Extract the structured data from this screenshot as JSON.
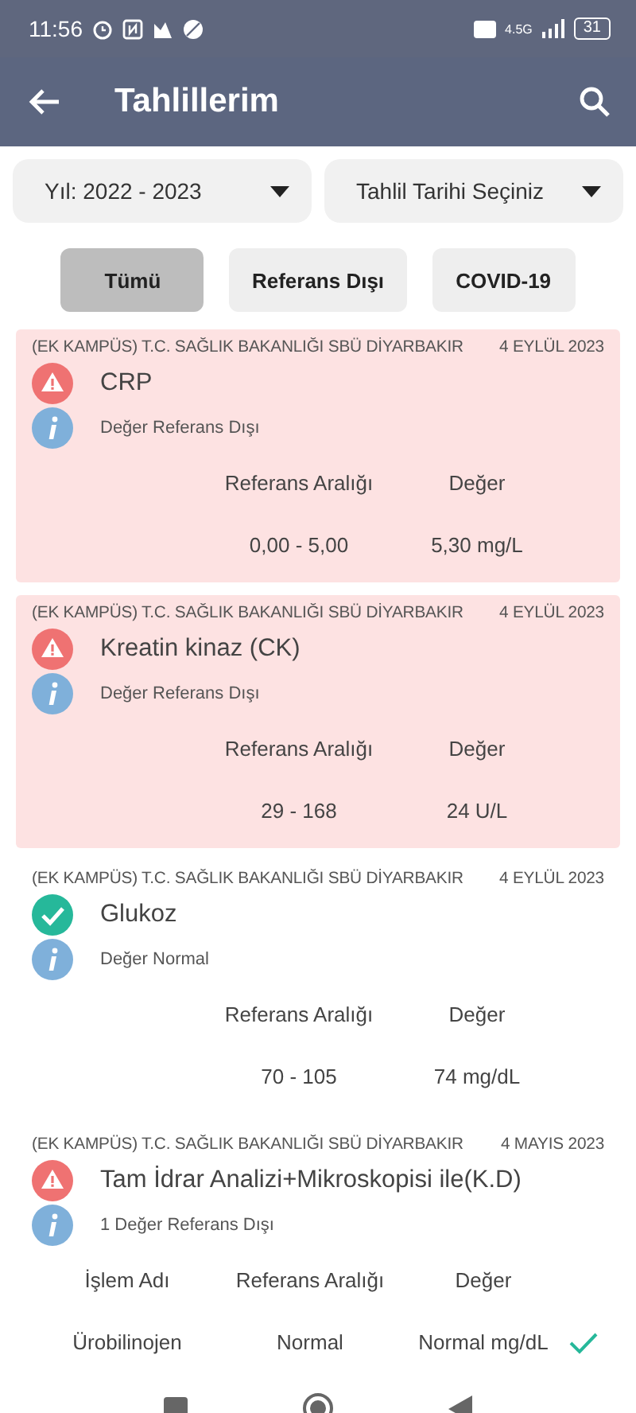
{
  "status_bar": {
    "time": "11:56",
    "network": "4.5G",
    "battery": "31"
  },
  "app_bar": {
    "title": "Tahlillerim"
  },
  "filters": [
    {
      "label": "Yıl: 2022 - 2023"
    },
    {
      "label": "Tahlil Tarihi Seçiniz"
    }
  ],
  "tabs": [
    {
      "label": "Tümü",
      "selected": true
    },
    {
      "label": "Referans Dışı",
      "selected": false
    },
    {
      "label": "COVID-19",
      "selected": false
    }
  ],
  "results": [
    {
      "facility": "(EK KAMPÜS) T.C. SAĞLIK BAKANLIĞI SBÜ DİYARBAKIR",
      "date": "4 EYLÜL 2023",
      "name": "CRP",
      "abnormal": true,
      "highlighted": true,
      "note": "Değer Referans Dışı",
      "columns": [
        "Referans Aralığı",
        "Değer"
      ],
      "rows": [
        {
          "cells": [
            "0,00 - 5,00",
            "5,30 mg/L"
          ]
        }
      ]
    },
    {
      "facility": "(EK KAMPÜS) T.C. SAĞLIK BAKANLIĞI SBÜ DİYARBAKIR",
      "date": "4 EYLÜL 2023",
      "name": "Kreatin kinaz (CK)",
      "abnormal": true,
      "highlighted": true,
      "note": "Değer Referans Dışı",
      "columns": [
        "Referans Aralığı",
        "Değer"
      ],
      "rows": [
        {
          "cells": [
            "29 - 168",
            "24 U/L"
          ]
        }
      ]
    },
    {
      "facility": "(EK KAMPÜS) T.C. SAĞLIK BAKANLIĞI SBÜ DİYARBAKIR",
      "date": "4 EYLÜL 2023",
      "name": "Glukoz",
      "abnormal": false,
      "highlighted": false,
      "note": "Değer Normal",
      "columns": [
        "Referans Aralığı",
        "Değer"
      ],
      "rows": [
        {
          "cells": [
            "70 - 105",
            "74 mg/dL"
          ]
        }
      ]
    },
    {
      "facility": "(EK KAMPÜS) T.C. SAĞLIK BAKANLIĞI SBÜ DİYARBAKIR",
      "date": "4 MAYIS 2023",
      "name": "Tam İdrar Analizi+Mikroskopisi ile(K.D)",
      "abnormal": true,
      "highlighted": false,
      "note": "1 Değer Referans Dışı",
      "columns": [
        "İşlem Adı",
        "Referans Aralığı",
        "Değer"
      ],
      "rows": [
        {
          "cells": [
            "Ürobilinojen",
            "Normal",
            "Normal mg/dL"
          ],
          "normal": true
        }
      ]
    }
  ]
}
